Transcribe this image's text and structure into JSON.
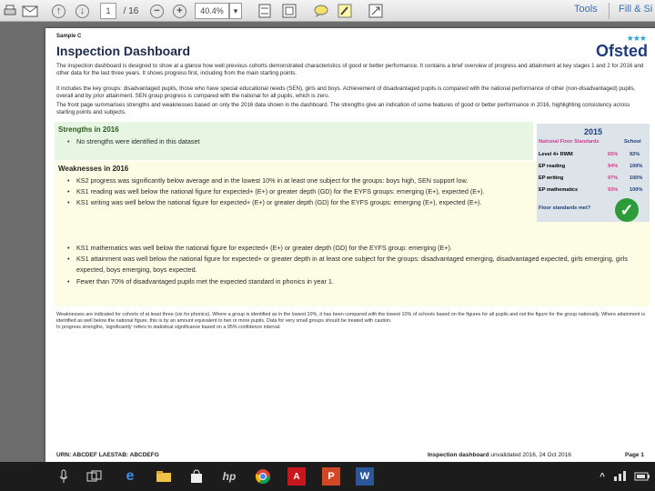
{
  "toolbar": {
    "page_current": "1",
    "page_total": "/ 16",
    "zoom_value": "40.4%",
    "tools_label": "Tools",
    "fill_sign_label": "Fill & Si"
  },
  "page": {
    "sample_label": "Sample C",
    "title": "Inspection Dashboard",
    "logo_text": "Ofsted",
    "intro_paragraphs": [
      "The inspection dashboard is designed to show at a glance how well previous cohorts demonstrated characteristics of good or better performance. It contains a brief overview of progress and attainment at key stages 1 and 2 for 2016 and other data for the last three years. It shows progress first, including from the main starting points.",
      "It includes the key groups: disadvantaged pupils, those who have special educational needs (SEN), girls and boys. Achievement of disadvantaged pupils is compared with the national performance of other (non-disadvantaged) pupils, overall and by prior attainment. SEN group progress is compared with the national for all pupils, which is zero.",
      "The front page summarises strengths and weaknesses based on only the 2016 data shown in the dashboard. The strengths give an indication of some features of good or better performance in 2016, highlighting consistency across starting points and subjects."
    ],
    "strengths": {
      "title": "Strengths in 2016",
      "items": [
        "No strengths were identified in this dataset"
      ]
    },
    "weaknesses": {
      "title": "Weaknesses in 2016",
      "items": [
        "KS2 progress was significantly below average and in the lowest 10% in at least one subject for the groups: boys high, SEN support low.",
        "KS1 reading was well below the national figure for expected+ (E+) or greater depth (GD) for the EYFS groups: emerging (E+), expected (E+).",
        "KS1 writing was well below the national figure for expected+ (E+) or greater depth (GD) for the EYFS groups: emerging (E+), expected (E+).",
        "KS1 mathematics was well below the national figure for expected+ (E+) or greater depth (GD) for the EYFS group: emerging (E+).",
        "KS1 attainment was well below the national figure for expected+ or greater depth in at least one subject for the groups: disadvantaged emerging, disadvantaged expected, girls emerging, girls expected, boys emerging, boys expected.",
        "Fewer than 70% of disadvantaged pupils met the expected standard in phonics in year 1."
      ]
    },
    "floor_standards": {
      "year": "2015",
      "header_left": "National Floor Standards",
      "header_right": "School",
      "rows": [
        {
          "label": "Level 4+ RWM",
          "national": "65%",
          "school": "92%"
        },
        {
          "label": "EP reading",
          "national": "94%",
          "school": "100%"
        },
        {
          "label": "EP writing",
          "national": "97%",
          "school": "100%"
        },
        {
          "label": "EP mathematics",
          "national": "93%",
          "school": "100%"
        }
      ],
      "met_label": "Floor standards met?",
      "met_icon": "✓"
    },
    "footnote_lines": [
      "Weaknesses are indicated for cohorts of at least three (six for phonics). Where a group is identified as in the lowest 10%, it has been compared with the lowest 10% of schools based on the figures for all pupils and not the figure for the group nationally. Where attainment is identified as well below the national figure, this is by an amount equivalent to two or more pupils. Data for very small groups should be treated with caution.",
      "In progress strengths, 'significantly' refers to statistical significance based on a 95% confidence interval."
    ],
    "footer": {
      "urn": "URN: ABCDEF   LAESTAB: ABCDEFG",
      "dashboard_label": "Inspection dashboard",
      "dashboard_date": "unvalidated 2016, 24 Oct 2016",
      "page_label": "Page 1"
    }
  },
  "colors": {
    "strengths_bg": "#e7f6e3",
    "weak_bg": "#fdfde6",
    "floor_bg": "#dce4ea",
    "national_pink": "#d23a8c",
    "ofsted_blue": "#1f3d7a",
    "tick_green": "#2d9b3a"
  }
}
